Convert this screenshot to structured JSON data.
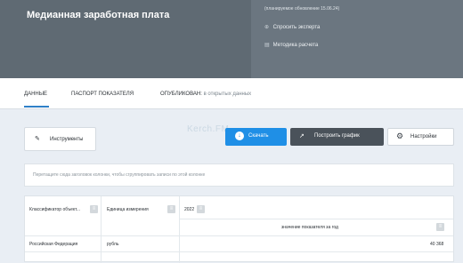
{
  "header": {
    "title": "Медианная заработная плата",
    "update_date": "(планируемое обновление 15.06.24)",
    "link_expert": "Спросить эксперта",
    "link_method": "Методика расчета"
  },
  "tabs": [
    {
      "label": "ДАННЫЕ"
    },
    {
      "label": "ПАСПОРТ ПОКАЗАТЕЛЯ"
    },
    {
      "label": "ОПУБЛИКОВАН:",
      "sub": "в открытых данных"
    }
  ],
  "toolbar": {
    "tools_label": "Инструменты",
    "download_label": "Скачать",
    "chart_label": "Построить график",
    "settings_label": "Настройки"
  },
  "watermark": "Kerch.FM",
  "grouping_hint": "Перетащите сюда заголовок колонки, чтобы сгруппировать записи по этой колонке",
  "table": {
    "columns": [
      "Классификатор объект...",
      "Единица измерения",
      "2022"
    ],
    "value_header": "значение показателя за год",
    "rows": [
      {
        "region": "Российская Федерация",
        "unit": "рубль",
        "value": "40 368"
      }
    ]
  }
}
